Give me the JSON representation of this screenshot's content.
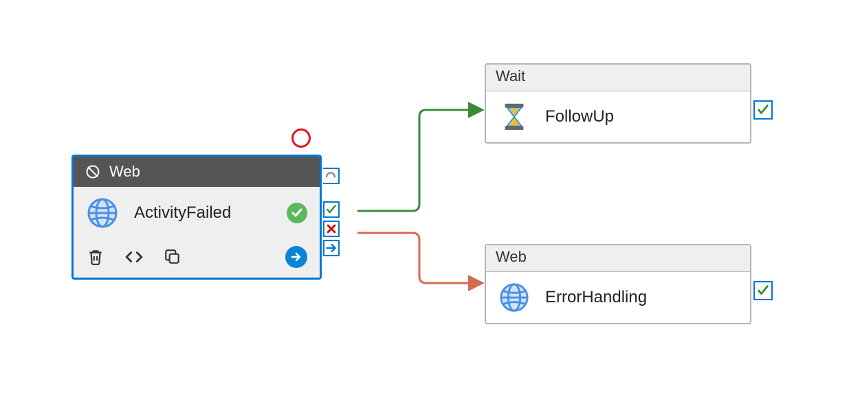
{
  "nodes": {
    "activityFailed": {
      "type_label": "Web",
      "name": "ActivityFailed",
      "selected": true,
      "status": "succeeded"
    },
    "followUp": {
      "type_label": "Wait",
      "name": "FollowUp",
      "status": "valid"
    },
    "errorHandling": {
      "type_label": "Web",
      "name": "ErrorHandling",
      "status": "valid"
    }
  },
  "ports": {
    "completion_icon": "completion",
    "success_icon": "check",
    "failure_icon": "x",
    "skip_icon": "arrow"
  },
  "connectors": [
    {
      "from": "activityFailed",
      "to": "followUp",
      "type": "success",
      "color": "#3b8a3b"
    },
    {
      "from": "activityFailed",
      "to": "errorHandling",
      "type": "failure",
      "color": "#d46a54"
    }
  ],
  "actions": {
    "delete": "Delete",
    "code": "Code",
    "clone": "Clone",
    "open": "Open"
  }
}
